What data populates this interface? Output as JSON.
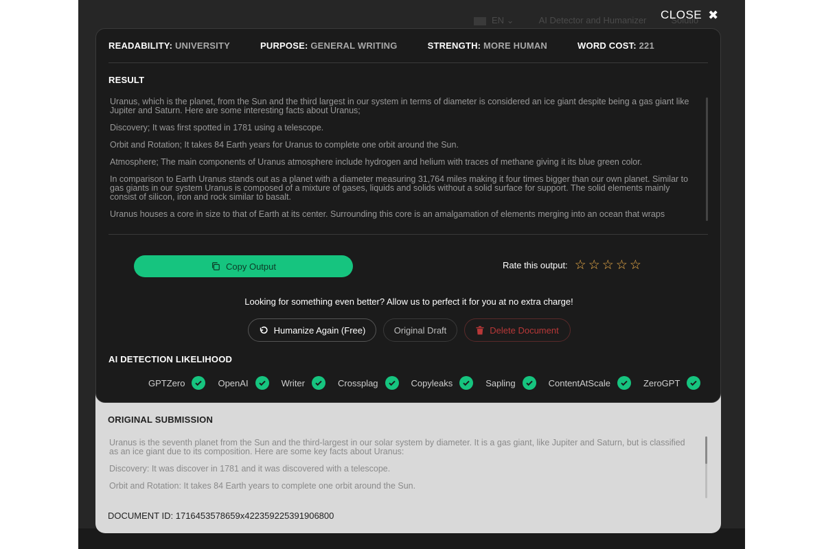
{
  "header": {
    "close_label": "CLOSE",
    "nav_language": "EN",
    "nav_link": "AI Detector and Humanizer",
    "nav_link2": "Solutio"
  },
  "meta": [
    {
      "key": "READABILITY:",
      "value": "UNIVERSITY"
    },
    {
      "key": "PURPOSE:",
      "value": "GENERAL WRITING"
    },
    {
      "key": "STRENGTH:",
      "value": "MORE HUMAN"
    },
    {
      "key": "WORD COST:",
      "value": "221"
    }
  ],
  "result": {
    "title": "RESULT",
    "paragraphs": [
      "Uranus, which is the planet, from the Sun and the third largest in our system in terms of diameter is considered an ice giant despite being a gas giant like Jupiter and Saturn. Here are some interesting facts about Uranus;",
      "Discovery; It was first spotted in 1781 using a telescope.",
      "Orbit and Rotation; It takes 84 Earth years for Uranus to complete one orbit around the Sun.",
      "Atmosphere; The main components of Uranus atmosphere include hydrogen and helium with traces of methane giving it its blue green color.",
      "In comparison to Earth Uranus stands out as a planet with a diameter measuring 31,764 miles making it four times bigger than our own planet. Similar to gas giants in our system Uranus is composed of a mixture of gases, liquids and solids without a solid surface for support. The solid elements mainly consist of silicon, iron and rock similar to basalt.",
      "Uranus houses a core in size to that of Earth at its center. Surrounding this core is an amalgamation of elements merging into an ocean that wraps"
    ]
  },
  "actions": {
    "copy_label": "Copy Output",
    "rate_label": "Rate this output:",
    "rating": 0,
    "rating_max": 5,
    "cta_text": "Looking for something even better? Allow us to perfect it for you at no extra charge!",
    "humanize_label": "Humanize Again (Free)",
    "draft_label": "Original Draft",
    "delete_label": "Delete Document"
  },
  "detection": {
    "title": "AI DETECTION LIKELIHOOD",
    "detectors": [
      "GPTZero",
      "OpenAI",
      "Writer",
      "Crossplag",
      "Copyleaks",
      "Sapling",
      "ContentAtScale",
      "ZeroGPT"
    ]
  },
  "original": {
    "title": "ORIGINAL SUBMISSION",
    "paragraphs": [
      "Uranus is the seventh planet from the Sun and the third-largest in our solar system by diameter. It is a gas giant, like Jupiter and Saturn, but is classified as an ice giant due to its composition. Here are some key facts about Uranus:",
      "Discovery: It was discover in 1781 and it was discovered with a telescope.",
      "Orbit and Rotation: It takes 84 Earth years to complete one orbit around the Sun."
    ],
    "doc_id_label": "DOCUMENT ID:",
    "doc_id": "1716453578659x422359225391906800"
  },
  "colors": {
    "accent": "#16c47f",
    "star": "#f2b14a",
    "danger": "#b83838",
    "panel": "#1b1b1b",
    "panel_light": "#d9d9d9"
  }
}
